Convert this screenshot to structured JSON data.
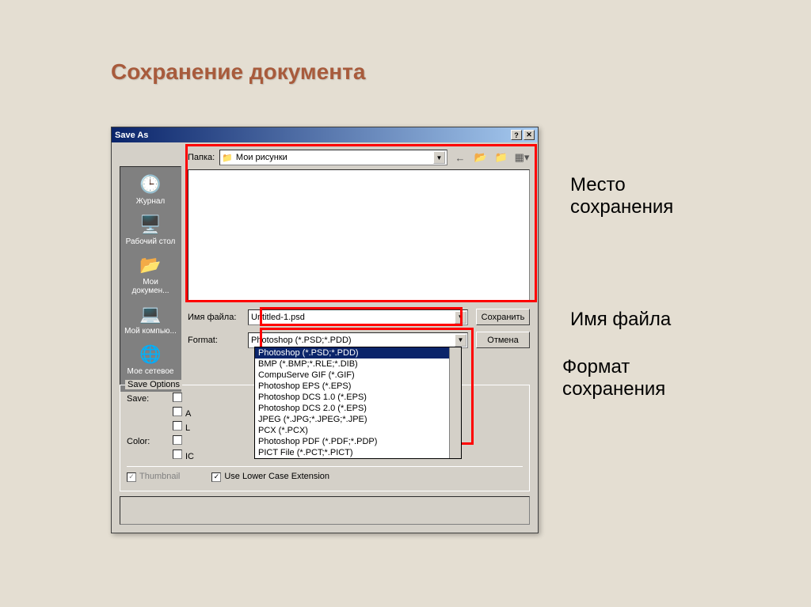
{
  "slide": {
    "title": "Сохранение документа"
  },
  "dialog": {
    "title": "Save As",
    "folder_label": "Папка:",
    "folder_value": "Мои рисунки",
    "places": [
      {
        "label": "Журнал"
      },
      {
        "label": "Рабочий стол"
      },
      {
        "label": "Мои докумен..."
      },
      {
        "label": "Мой компью..."
      },
      {
        "label": "Мое сетевое ..."
      }
    ],
    "filename_label": "Имя файла:",
    "filename_value": "Untitled-1.psd",
    "format_label": "Format:",
    "format_value": "Photoshop (*.PSD;*.PDD)",
    "format_options": [
      "Photoshop (*.PSD;*.PDD)",
      "BMP (*.BMP;*.RLE;*.DIB)",
      "CompuServe GIF (*.GIF)",
      "Photoshop EPS (*.EPS)",
      "Photoshop DCS 1.0 (*.EPS)",
      "Photoshop DCS 2.0 (*.EPS)",
      "JPEG (*.JPG;*.JPEG;*.JPE)",
      "PCX (*.PCX)",
      "Photoshop PDF (*.PDF;*.PDP)",
      "PICT File (*.PCT;*.PICT)"
    ],
    "save_button": "Сохранить",
    "cancel_button": "Отмена",
    "save_options_label": "Save Options",
    "save_label": "Save:",
    "color_label": "Color:",
    "thumbnail_label": "Thumbnail",
    "lowercase_label": "Use Lower Case Extension"
  },
  "annotations": {
    "location": "Место сохранения",
    "filename": "Имя файла",
    "format": "Формат сохранения"
  }
}
